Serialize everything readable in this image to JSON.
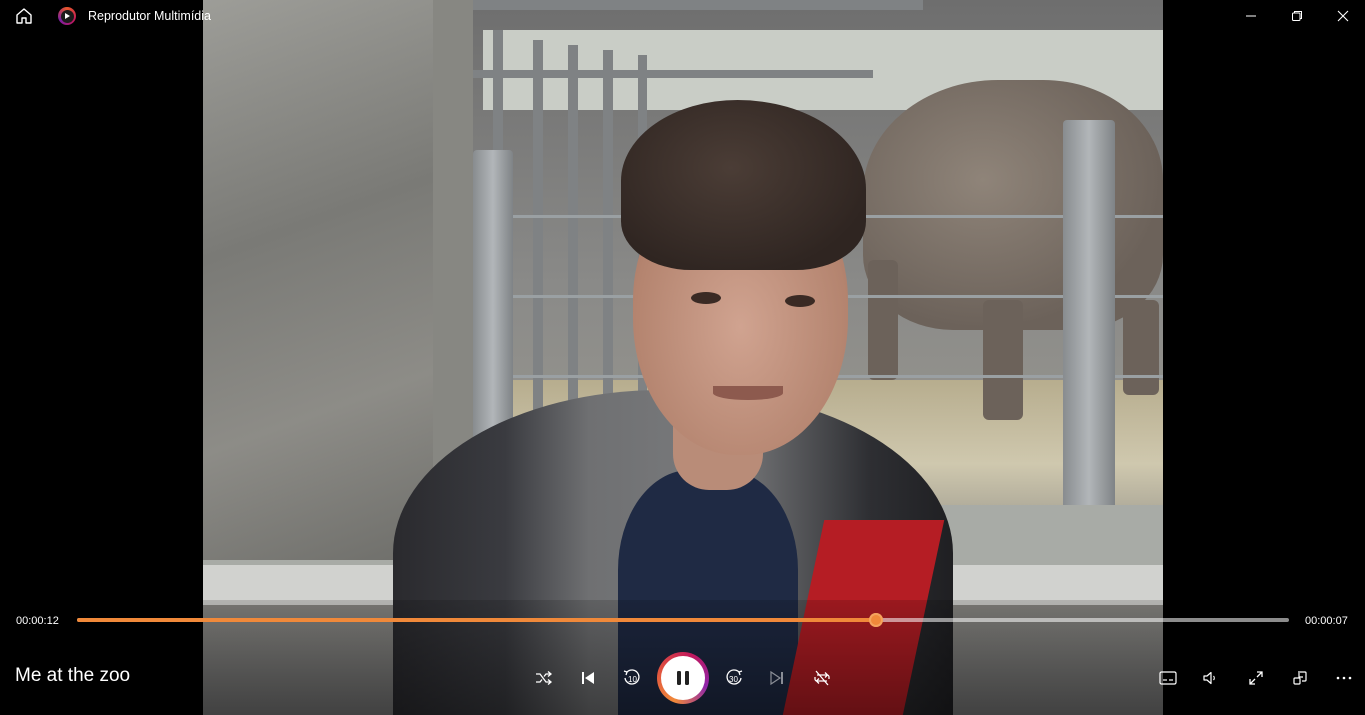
{
  "window": {
    "title": "Reprodutor Multimídia",
    "icons": {
      "home": "home-icon",
      "app": "media-player-app-icon",
      "minimize": "minimize-icon",
      "maximize": "restore-icon",
      "close": "close-icon"
    }
  },
  "video": {
    "description_icon": "video-frame"
  },
  "playback": {
    "elapsed": "00:00:12",
    "remaining": "00:00:07",
    "progress": 0.659,
    "title": "Me at the zoo",
    "accent_color": "#f0893a"
  },
  "controls": {
    "shuffle": "shuffle-icon",
    "previous": "previous-icon",
    "skip_back": "skip-back-10-icon",
    "skip_back_label": "10",
    "play_pause": "pause-icon",
    "skip_forward": "skip-forward-30-icon",
    "skip_forward_label": "30",
    "next": "next-icon",
    "repeat": "repeat-off-icon",
    "captions": "captions-icon",
    "volume": "volume-icon",
    "fullscreen": "fullscreen-icon",
    "miniplayer": "miniplayer-icon",
    "more": "more-icon"
  }
}
